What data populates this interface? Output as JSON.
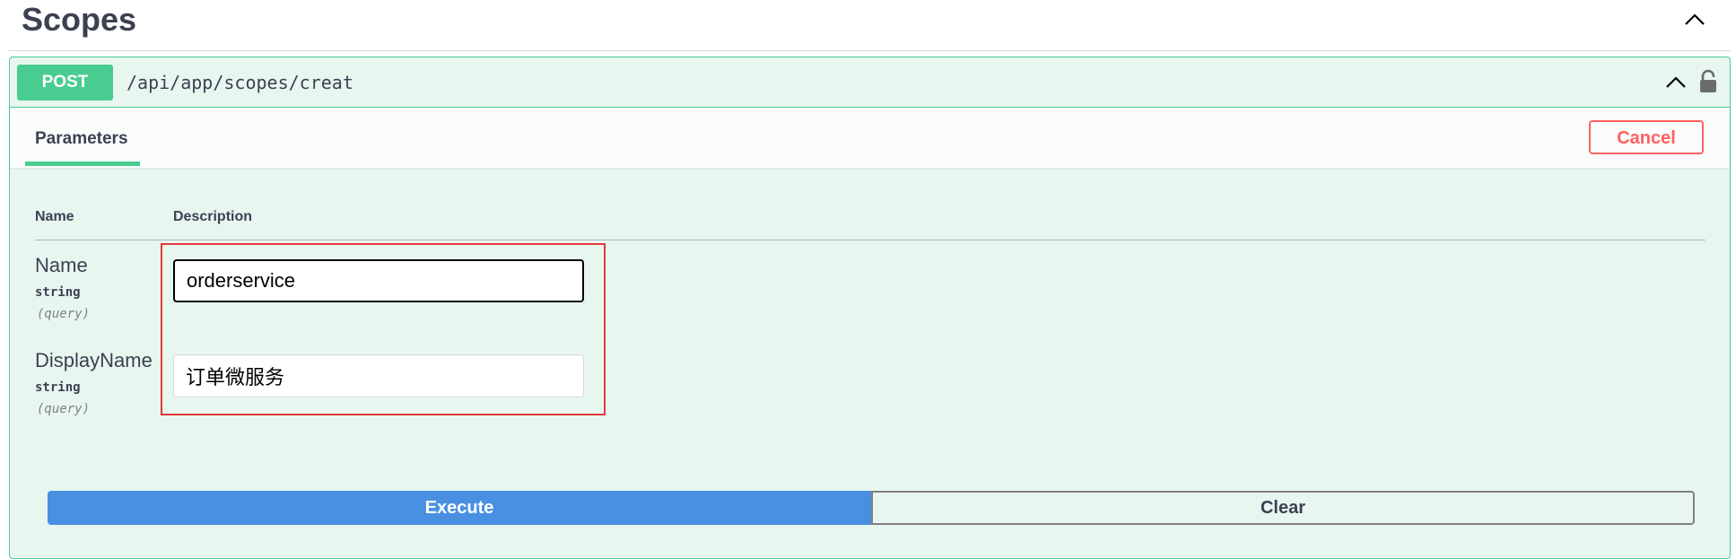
{
  "section": {
    "title": "Scopes",
    "toggle_icon": "chevron-up-icon"
  },
  "operation": {
    "method": "POST",
    "path": "/api/app/scopes/creat",
    "collapse_icon": "chevron-up-icon",
    "lock_icon": "lock-icon",
    "colors": {
      "method_bg": "#49cc90",
      "block_bg": "#e8f6f0",
      "border": "#49cc90"
    }
  },
  "tabs": {
    "parameters_label": "Parameters",
    "cancel_label": "Cancel",
    "cancel_color": "#ff6060"
  },
  "table": {
    "headers": [
      "Name",
      "Description"
    ],
    "params": [
      {
        "name": "Name",
        "type": "string",
        "in": "(query)",
        "value": "orderservice"
      },
      {
        "name": "DisplayName",
        "type": "string",
        "in": "(query)",
        "value": "订单微服务"
      }
    ]
  },
  "actions": {
    "execute_label": "Execute",
    "clear_label": "Clear",
    "execute_color": "#4990e2"
  },
  "annotation": {
    "highlight_color": "#e23a3a"
  }
}
